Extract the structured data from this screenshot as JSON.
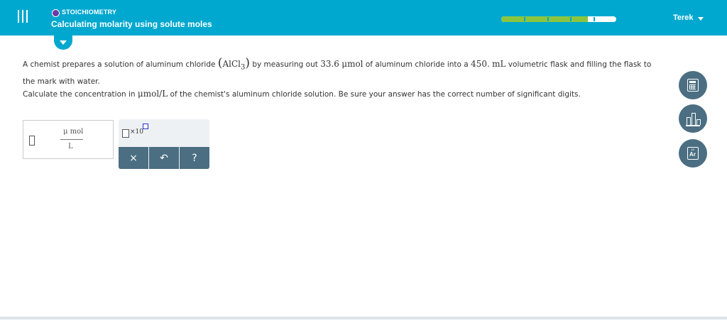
{
  "header": {
    "module_label": "STOICHIOMETRY",
    "topic_title": "Calculating molarity using solute moles",
    "progress_fraction": 0.75,
    "progress_segments": 5,
    "user_name": "Terek"
  },
  "question": {
    "p1_pre": "A chemist prepares a solution of aluminum chloride ",
    "formula_base": "AlCl",
    "formula_sub": "3",
    "p1_mid1": " by measuring out ",
    "amount": "33.6",
    "amount_unit": "μmol",
    "p1_mid2": " of aluminum chloride into a ",
    "volume": "450.",
    "volume_unit": "mL",
    "p1_post": " volumetric flask and filling the flask to the mark with water.",
    "p2_pre": "Calculate the concentration in ",
    "conc_unit": "μmol/L",
    "p2_post": " of the chemist's aluminum chloride solution. Be sure your answer has the correct number of significant digits."
  },
  "answer": {
    "unit_numerator": "μ mol",
    "unit_denominator": "L",
    "sci_notation_label": "×10"
  },
  "toolbar": {
    "clear_label": "×",
    "undo_label": "↶",
    "help_label": "?"
  },
  "side_tools": {
    "periodic_symbol": "Ar",
    "periodic_number": "18"
  },
  "colors": {
    "header_bg": "#00a8cf",
    "progress_fill": "#8bc53f",
    "tool_bg": "#4b6e82",
    "module_dot": "#6b3aa3"
  }
}
